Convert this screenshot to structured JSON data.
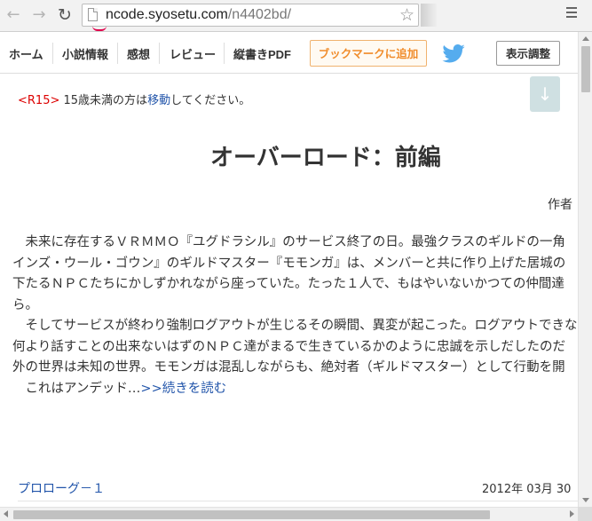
{
  "browser": {
    "url_host": "ncode.syosetu.com",
    "url_path": "/n4402bd/"
  },
  "nav": {
    "home": "ホーム",
    "info": "小説情報",
    "impressions": "感想",
    "review": "レビュー",
    "vertical_pdf": "縦書きPDF",
    "bookmark": "ブックマークに追加",
    "display_settings": "表示調整"
  },
  "notice": {
    "r15": "<R15>",
    "text_before": " 15歳未満の方は",
    "link": "移動",
    "text_after": "してください。"
  },
  "down_arrow": "↓",
  "novel": {
    "title": "オーバーロード：前編",
    "author_label": "作者"
  },
  "synopsis": {
    "lines": [
      "　未来に存在するＶＲＭＭＯ『ユグドラシル』のサービス終了の日。最強クラスのギルドの一角",
      "インズ・ウール・ゴウン』のギルドマスター『モモンガ』は、メンバーと共に作り上げた居城の",
      "下たるＮＰＣたちにかしずかれながら座っていた。たった１人で、もはやいないかつての仲間達",
      "ら。",
      "　そしてサービスが終わり強制ログアウトが生じるその瞬間、異変が起こった。ログアウトできな",
      "何より話すことの出来ないはずのＮＰＣ達がまるで生きているかのように忠誠を示しだしたのだ",
      "外の世界は未知の世界。モモンガは混乱しながらも、絶対者（ギルドマスター）として行動を開"
    ],
    "last_prefix": "　これはアンデッド…",
    "read_more": ">>続きを読む"
  },
  "chapter": {
    "title": "プロローグ－１",
    "date": "2012年 03月 30"
  },
  "colors": {
    "link": "#2255aa",
    "r15": "#dd0000",
    "bookmark_text": "#f08c2b",
    "twitter": "#55acee"
  }
}
